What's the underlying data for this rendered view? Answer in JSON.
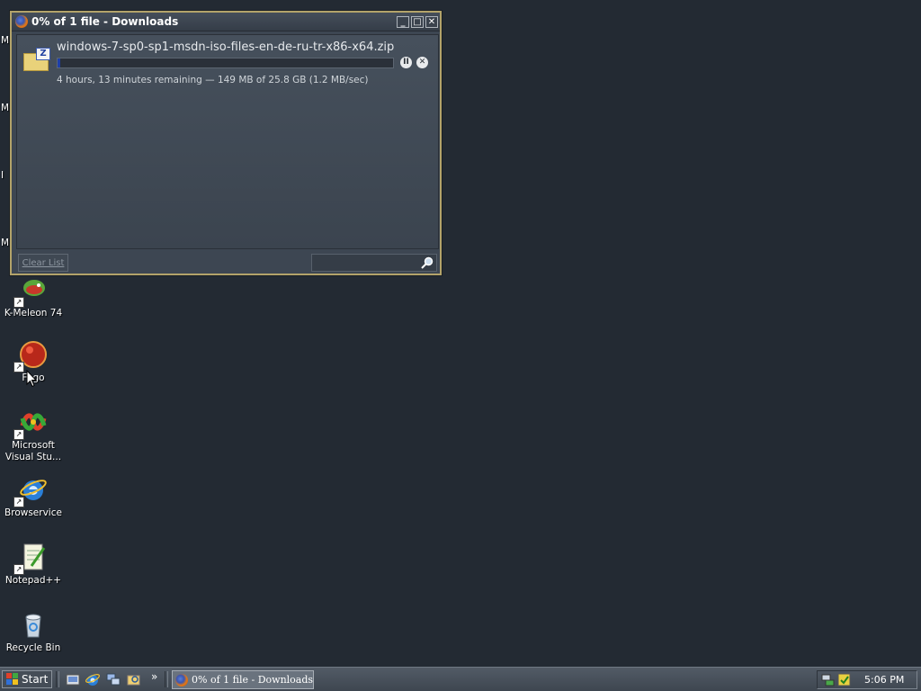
{
  "desktop": {
    "edge_letters": [
      "M",
      "M",
      "I",
      "M"
    ],
    "icons": [
      {
        "label": "K-Meleon 74",
        "icon": "k-meleon-icon"
      },
      {
        "label": "Fogo",
        "icon": "fogo-icon"
      },
      {
        "label": "Microsoft Visual Stu...",
        "icon": "visual-studio-icon"
      },
      {
        "label": "Browservice",
        "icon": "ie-icon"
      },
      {
        "label": "Notepad++",
        "icon": "notepadpp-icon"
      },
      {
        "label": "Recycle Bin",
        "icon": "recycle-bin-icon"
      }
    ]
  },
  "window": {
    "title": "0% of 1 file - Downloads",
    "controls": {
      "minimize": "_",
      "maximize": "□",
      "close": "✕"
    },
    "download": {
      "filename": "windows-7-sp0-sp1-msdn-iso-files-en-de-ru-tr-x86-x64.zip",
      "progress_fraction": 0.006,
      "status": "4 hours, 13 minutes remaining — 149 MB of 25.8 GB (1.2 MB/sec)",
      "pause_glyph": "II",
      "cancel_glyph": "✕"
    },
    "clear_list_label": "Clear List",
    "search": {
      "value": "",
      "placeholder": ""
    }
  },
  "taskbar": {
    "start_label": "Start",
    "chevron": "»",
    "task_button_label": "0% of 1 file - Downloads",
    "clock": "5:06 PM"
  },
  "colors": {
    "desktop_bg": "#232a33",
    "window_border": "#b3a36a",
    "progress_fill": "#1e3fa8"
  }
}
